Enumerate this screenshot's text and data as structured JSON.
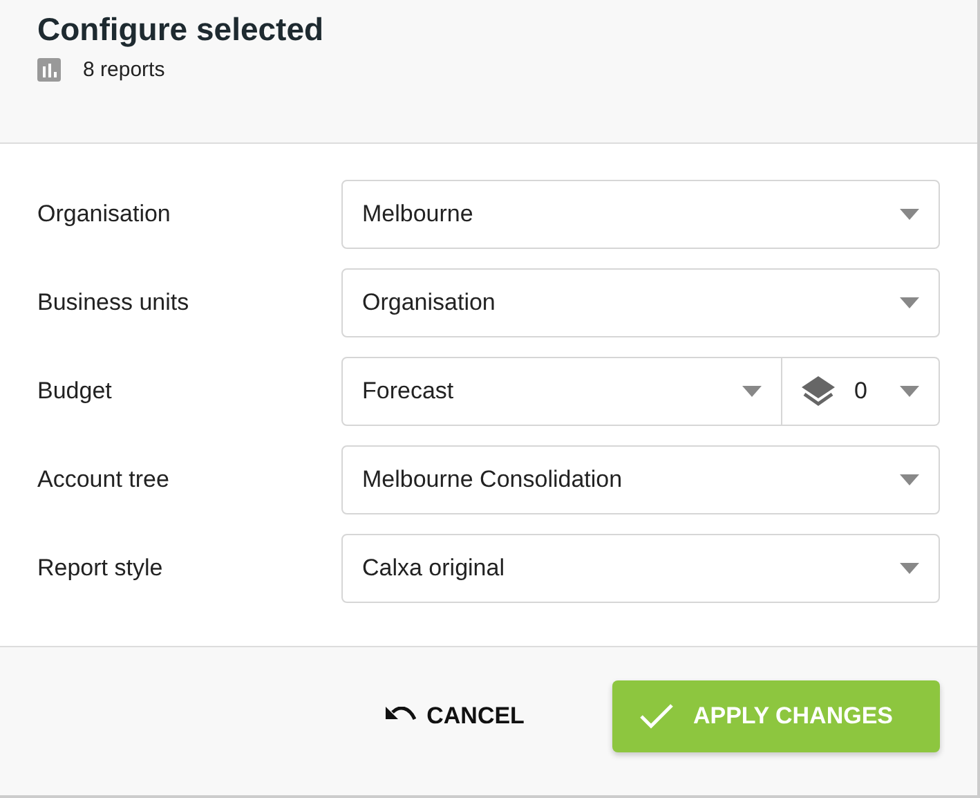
{
  "header": {
    "title": "Configure selected",
    "subtitle": "8 reports"
  },
  "fields": [
    {
      "kind": "select",
      "label": "Organisation",
      "value": "Melbourne"
    },
    {
      "kind": "select",
      "label": "Business units",
      "value": "Organisation"
    },
    {
      "kind": "split",
      "label": "Budget",
      "value": "Forecast",
      "version": "0"
    },
    {
      "kind": "select",
      "label": "Account tree",
      "value": "Melbourne Consolidation"
    },
    {
      "kind": "select",
      "label": "Report style",
      "value": "Calxa original"
    }
  ],
  "buttons": [
    {
      "kind": "cancel",
      "label": "CANCEL"
    },
    {
      "kind": "apply",
      "label": "APPLY CHANGES"
    }
  ]
}
